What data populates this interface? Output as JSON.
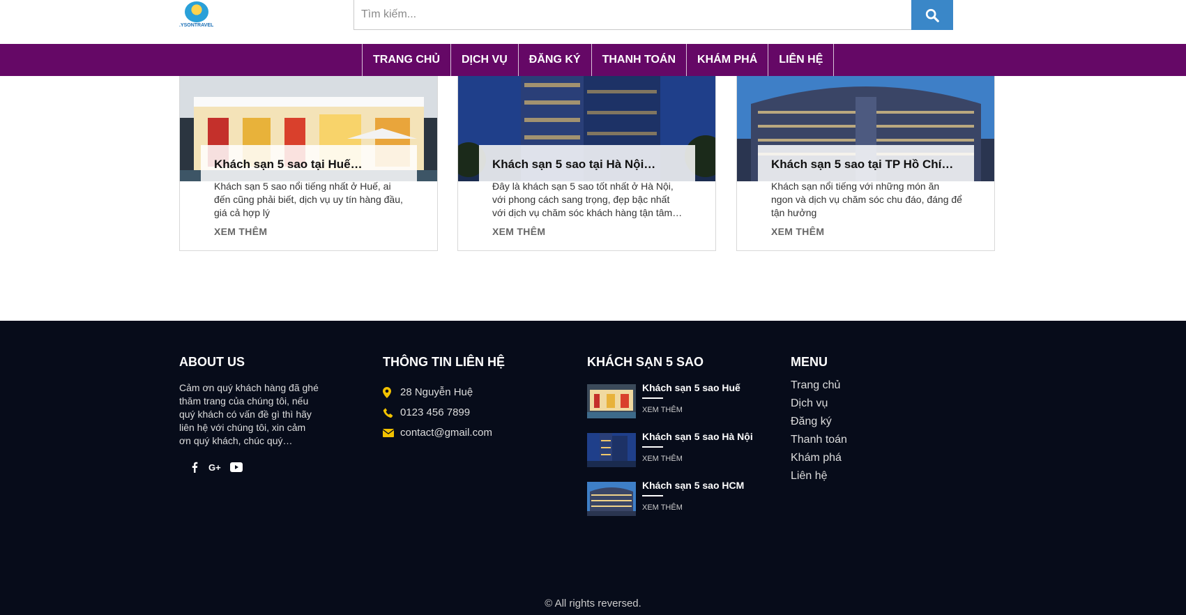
{
  "header": {
    "logo_text": ".YSONTRAVEL",
    "search_placeholder": "Tìm kiếm..."
  },
  "nav": {
    "items": [
      "TRANG CHỦ",
      "DỊCH VỤ",
      "ĐĂNG KÝ",
      "THANH TOÁN",
      "KHÁM PHÁ",
      "LIÊN HỆ"
    ]
  },
  "cards": [
    {
      "title": "Khách sạn 5 sao tại Huế…",
      "desc": "Khách sạn 5 sao nổi tiếng nhất ở Huế, ai đến cũng phải biết, dịch vụ uy tín hàng đầu, giá cả hợp lý",
      "more": "XEM THÊM"
    },
    {
      "title": "Khách sạn 5 sao tại Hà Nội…",
      "desc": "Đây là khách sạn 5 sao tốt nhất ở Hà Nội, với phong cách sang trọng, đẹp bậc nhất với dịch vụ chăm sóc khách hàng tận tâm…",
      "more": "XEM THÊM"
    },
    {
      "title": "Khách sạn 5 sao tại TP Hồ Chí…",
      "desc": "Khách sạn nổi tiếng với những món ăn ngon và dịch vụ chăm sóc chu đáo, đáng để tận hưởng",
      "more": "XEM THÊM"
    }
  ],
  "footer": {
    "about": {
      "title": "ABOUT US",
      "text": "Cảm ơn quý khách hàng đã ghé thăm trang của chúng tôi, nếu quý khách có vấn đề gì thì hãy liên hệ với chúng tôi, xin cảm ơn quý khách, chúc quý…"
    },
    "contact": {
      "title": "THÔNG TIN LIÊN HỆ",
      "address": "28 Nguyễn Huệ",
      "phone": "0123 456 7899",
      "email": "contact@gmail.com"
    },
    "hotels": {
      "title": "KHÁCH SẠN 5 SAO",
      "items": [
        {
          "name": "Khách sạn 5 sao Huế",
          "link": "XEM THÊM"
        },
        {
          "name": "Khách sạn 5 sao Hà Nội",
          "link": "XEM THÊM"
        },
        {
          "name": "Khách sạn 5 sao HCM",
          "link": "XEM THÊM"
        }
      ]
    },
    "menu": {
      "title": "MENU",
      "items": [
        "Trang chủ",
        "Dịch vụ",
        "Đăng ký",
        "Thanh toán",
        "Khám phá",
        "Liên hệ"
      ]
    },
    "copyright": "© All rights reversed."
  },
  "colors": {
    "nav_bg": "#650866",
    "search_button": "#3a87c8",
    "footer_bg": "#070c1a",
    "icon_accent": "#f2c200"
  }
}
